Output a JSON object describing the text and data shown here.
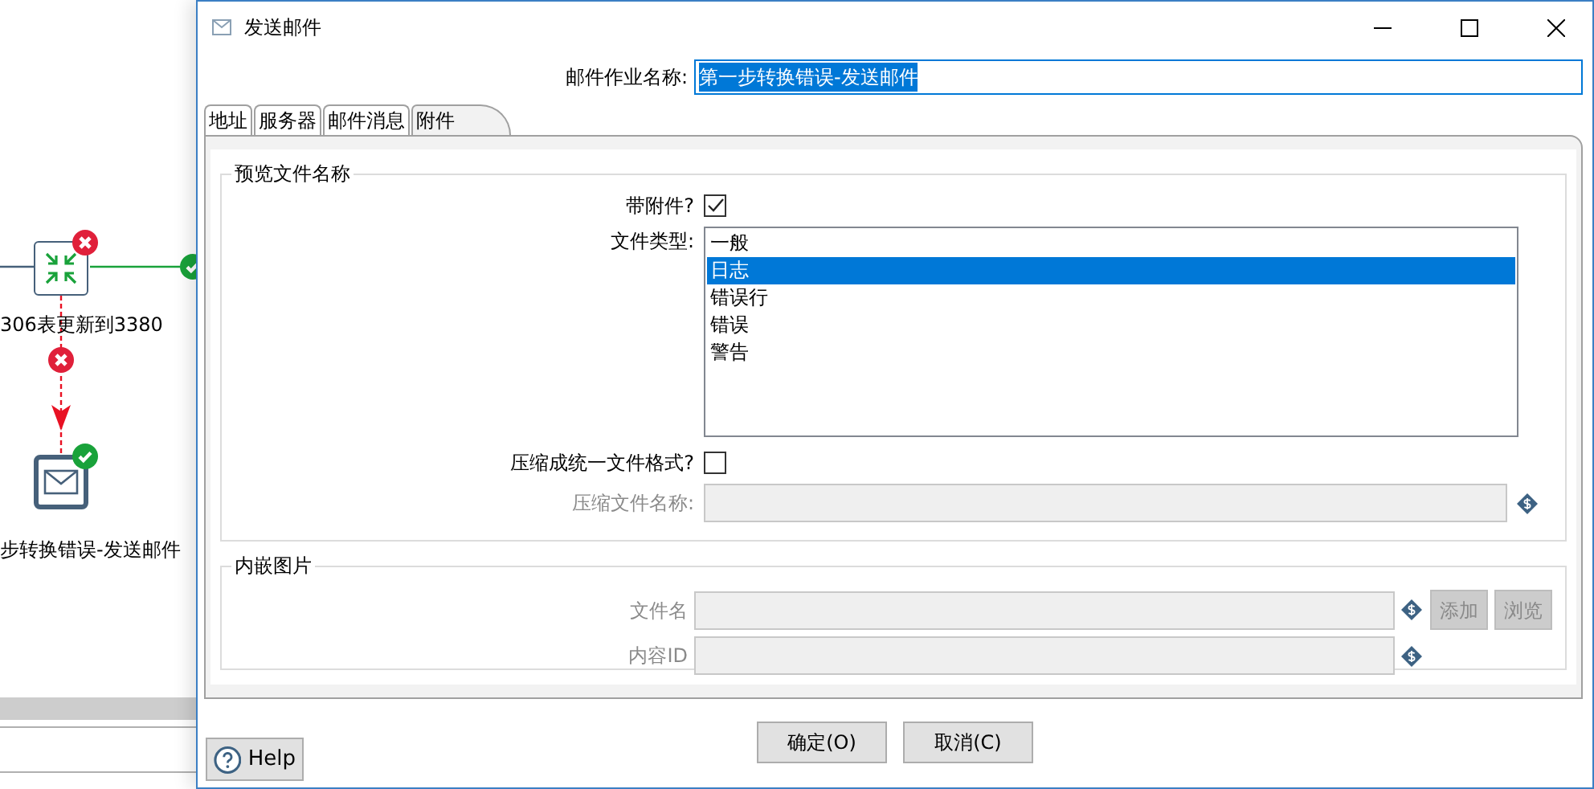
{
  "canvas": {
    "nodes": [
      {
        "label": "306表更新到3380",
        "kind": "merge",
        "has_error": true
      },
      {
        "label": "步转换错误-发送邮件",
        "kind": "mail",
        "has_error": false
      }
    ],
    "hops": [
      {
        "kind": "error"
      },
      {
        "kind": "ok"
      }
    ]
  },
  "window": {
    "title": "发送邮件"
  },
  "job_name": {
    "label": "邮件作业名称:",
    "value": "第一步转换错误-发送邮件",
    "text_selected": true
  },
  "tabs": [
    {
      "label": "地址",
      "selected": false
    },
    {
      "label": "服务器",
      "selected": false
    },
    {
      "label": "邮件消息",
      "selected": false
    },
    {
      "label": "附件",
      "selected": true
    }
  ],
  "preview_group": {
    "title": "预览文件名称",
    "attach": {
      "label": "带附件?",
      "checked": true
    },
    "file_type": {
      "label": "文件类型:",
      "items": [
        {
          "label": "一般",
          "selected": false
        },
        {
          "label": "日志",
          "selected": true
        },
        {
          "label": "错误行",
          "selected": false
        },
        {
          "label": "错误",
          "selected": false
        },
        {
          "label": "警告",
          "selected": false
        }
      ]
    },
    "zip": {
      "label": "压缩成统一文件格式?",
      "checked": false
    },
    "zip_name": {
      "label": "压缩文件名称:",
      "disabled": true
    }
  },
  "embed_group": {
    "title": "内嵌图片",
    "fields": [
      {
        "label": "文件名",
        "disabled": true
      },
      {
        "label": "内容ID",
        "disabled": true
      }
    ],
    "buttons": [
      {
        "label": "添加",
        "disabled": true
      },
      {
        "label": "浏览",
        "disabled": true
      }
    ]
  },
  "footer": {
    "help": "Help",
    "buttons": [
      "确定(O)",
      "取消(C)"
    ]
  }
}
